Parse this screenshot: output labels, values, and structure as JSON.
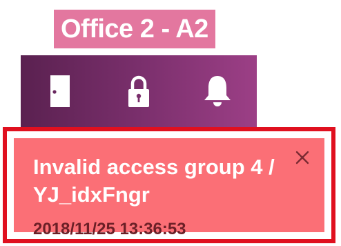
{
  "room": {
    "title": "Office 2 - A2"
  },
  "toolbar": {
    "icons": [
      "door-icon",
      "lock-icon",
      "bell-icon"
    ]
  },
  "alert": {
    "message": "Invalid access group 4 / YJ_idxFngr",
    "timestamp": "2018/11/25 13:36:53",
    "close_icon": "close-icon",
    "background_color": "#fb6f76",
    "border_color": "#e0101f"
  },
  "colors": {
    "title_bg": "#e3779f",
    "bar_gradient_start": "#5a2150",
    "bar_gradient_end": "#9c3f86"
  }
}
